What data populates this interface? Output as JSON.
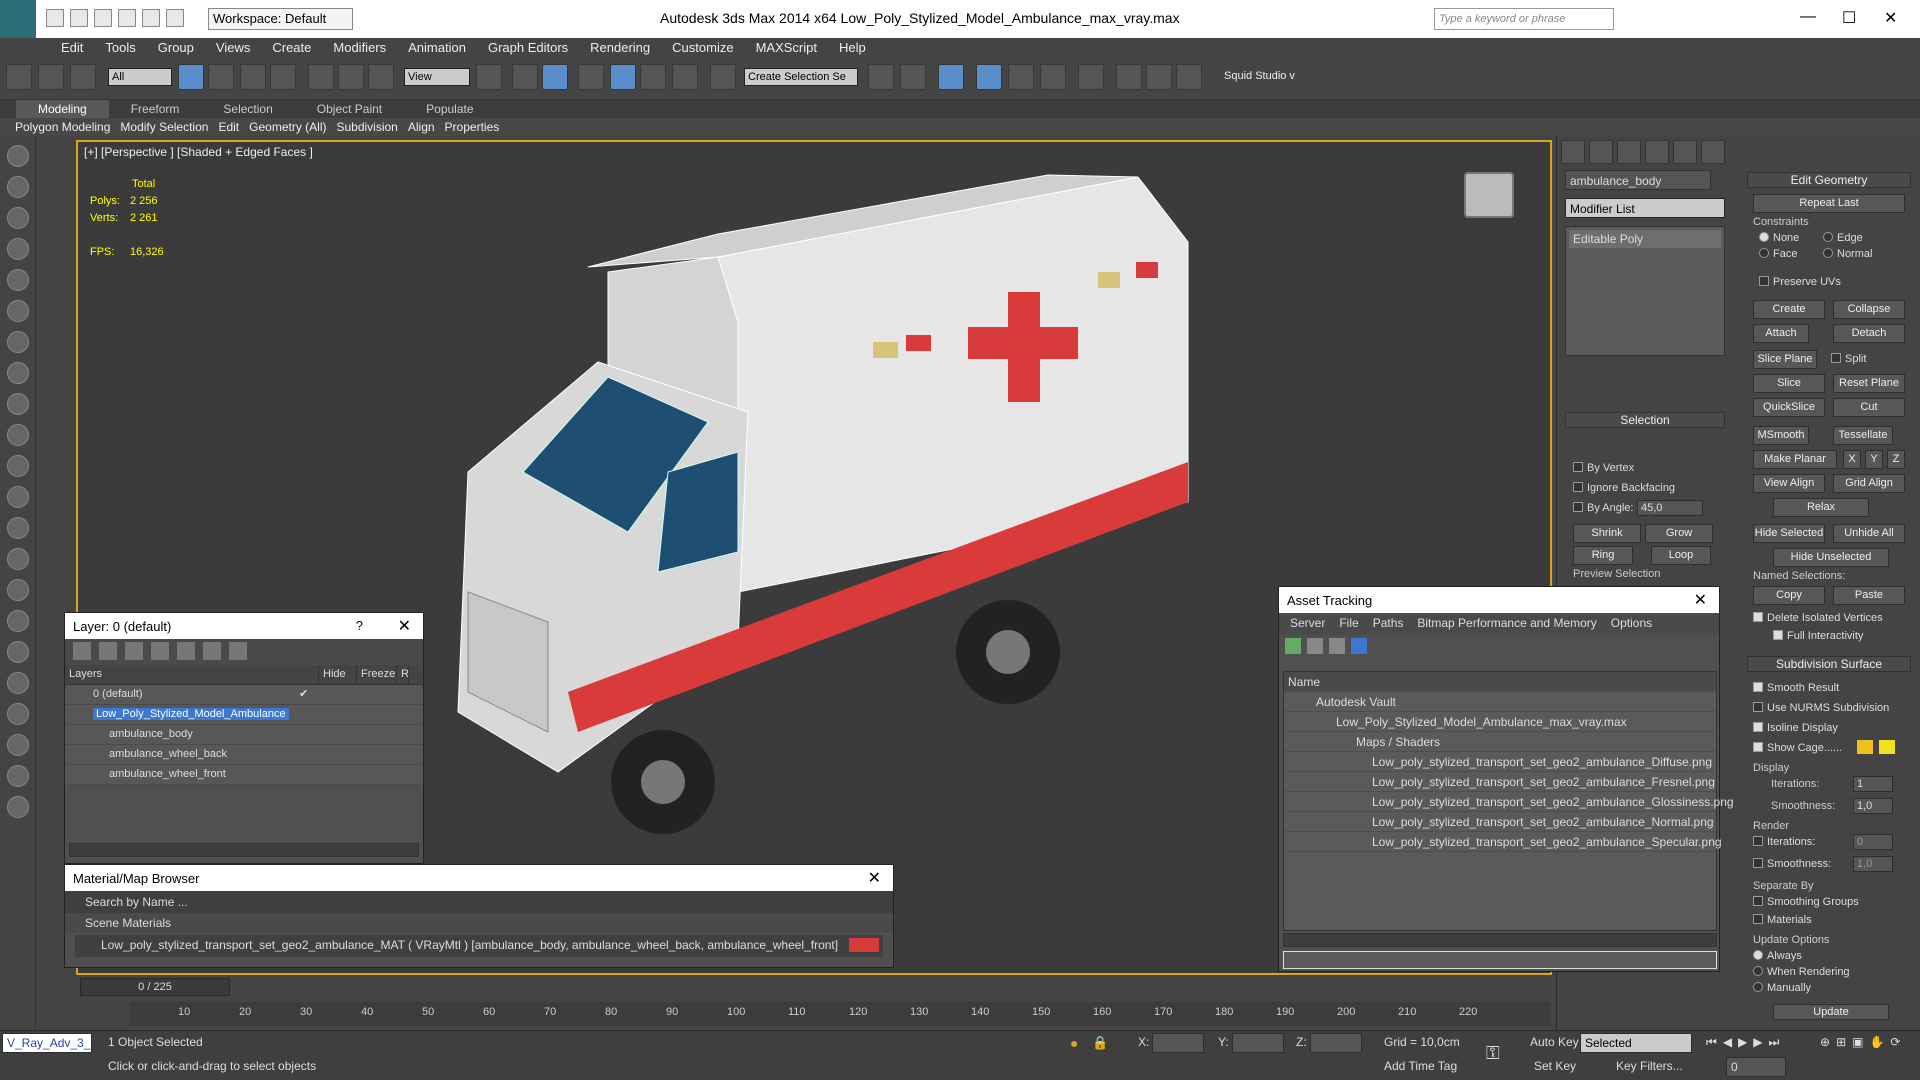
{
  "title": "Autodesk 3ds Max  2014 x64     Low_Poly_Stylized_Model_Ambulance_max_vray.max",
  "workspace": "Workspace: Default",
  "search_placeholder": "Type a keyword or phrase",
  "menu": [
    "Edit",
    "Tools",
    "Group",
    "Views",
    "Create",
    "Modifiers",
    "Animation",
    "Graph Editors",
    "Rendering",
    "Customize",
    "MAXScript",
    "Help"
  ],
  "toolbar": {
    "filter": "All",
    "refcoord": "View",
    "selset": "Create Selection Se",
    "studio": "Squid Studio v"
  },
  "ribbon_tabs": [
    "Modeling",
    "Freeform",
    "Selection",
    "Object Paint",
    "Populate"
  ],
  "ribbon_items": [
    "Polygon Modeling",
    "Modify Selection",
    "Edit",
    "Geometry (All)",
    "Subdivision",
    "Align",
    "Properties"
  ],
  "viewport": {
    "label": "[+] [Perspective ] [Shaded + Edged Faces ]",
    "total": "Total",
    "polys_label": "Polys:",
    "polys": "2 256",
    "verts_label": "Verts:",
    "verts": "2 261",
    "fps_label": "FPS:",
    "fps": "16,326"
  },
  "cmd": {
    "objname": "ambulance_body",
    "modlist": "Modifier List",
    "stack": "Editable Poly",
    "selection": "Selection",
    "by_vertex": "By Vertex",
    "ignore_backfacing": "Ignore Backfacing",
    "by_angle": "By Angle:",
    "angle": "45,0",
    "shrink": "Shrink",
    "grow": "Grow",
    "ring": "Ring",
    "loop": "Loop",
    "preview": "Preview Selection",
    "edit_geometry": "Edit Geometry",
    "repeat_last": "Repeat Last",
    "constraints": "Constraints",
    "none": "None",
    "edge": "Edge",
    "face": "Face",
    "normal": "Normal",
    "preserve_uvs": "Preserve UVs",
    "create": "Create",
    "collapse": "Collapse",
    "attach": "Attach",
    "detach": "Detach",
    "slice_plane": "Slice Plane",
    "split": "Split",
    "slice": "Slice",
    "reset_plane": "Reset Plane",
    "quickslice": "QuickSlice",
    "cut": "Cut",
    "msmooth": "MSmooth",
    "tessellate": "Tessellate",
    "make_planar": "Make Planar",
    "x": "X",
    "y": "Y",
    "z": "Z",
    "view_align": "View Align",
    "grid_align": "Grid Align",
    "relax": "Relax",
    "hide_selected": "Hide Selected",
    "unhide_all": "Unhide All",
    "hide_unselected": "Hide Unselected",
    "named_sel": "Named Selections:",
    "copy": "Copy",
    "paste": "Paste",
    "delete_iso": "Delete Isolated Vertices",
    "full_inter": "Full Interactivity",
    "subdiv": "Subdivision Surface",
    "smooth_result": "Smooth Result",
    "use_nurms": "Use NURMS Subdivision",
    "isoline": "Isoline Display",
    "show_cage": "Show Cage......",
    "display": "Display",
    "iterations": "Iterations:",
    "iter_val": "1",
    "smoothness": "Smoothness:",
    "smooth_val": "1,0",
    "render": "Render",
    "r_iter": "0",
    "r_smooth": "1,0",
    "separate_by": "Separate By",
    "smoothing_groups": "Smoothing Groups",
    "materials": "Materials",
    "update_options": "Update Options",
    "always": "Always",
    "when_rendering": "When Rendering",
    "manually": "Manually",
    "update": "Update"
  },
  "layer": {
    "title": "Layer: 0 (default)",
    "help": "?",
    "col_layers": "Layers",
    "col_hide": "Hide",
    "col_freeze": "Freeze",
    "col_r": "R",
    "rows": [
      "0 (default)",
      "Low_Poly_Stylized_Model_Ambulance",
      "ambulance_body",
      "ambulance_wheel_back",
      "ambulance_wheel_front"
    ]
  },
  "matbrowser": {
    "title": "Material/Map Browser",
    "search": "Search by Name ...",
    "scene": "Scene Materials",
    "item": "Low_poly_stylized_transport_set_geo2_ambulance_MAT ( VRayMtl ) [ambulance_body, ambulance_wheel_back, ambulance_wheel_front]"
  },
  "asset": {
    "title": "Asset Tracking",
    "menu": [
      "Server",
      "File",
      "Paths",
      "Bitmap Performance and Memory",
      "Options"
    ],
    "col_name": "Name",
    "rows": [
      "Autodesk Vault",
      "Low_Poly_Stylized_Model_Ambulance_max_vray.max",
      "Maps / Shaders",
      "Low_poly_stylized_transport_set_geo2_ambulance_Diffuse.png",
      "Low_poly_stylized_transport_set_geo2_ambulance_Fresnel.png",
      "Low_poly_stylized_transport_set_geo2_ambulance_Glossiness.png",
      "Low_poly_stylized_transport_set_geo2_ambulance_Normal.png",
      "Low_poly_stylized_transport_set_geo2_ambulance_Specular.png"
    ]
  },
  "timeline": {
    "frame": "0 / 225",
    "ticks": [
      "10",
      "20",
      "30",
      "40",
      "50",
      "60",
      "70",
      "80",
      "90",
      "100",
      "110",
      "120",
      "130",
      "140",
      "150",
      "160",
      "170",
      "180",
      "190",
      "200",
      "210",
      "220"
    ]
  },
  "status": {
    "script": "V_Ray_Adv_3_",
    "selected": "1 Object Selected",
    "prompt": "Click or click-and-drag to select objects",
    "x_label": "X:",
    "y_label": "Y:",
    "z_label": "Z:",
    "grid": "Grid = 10,0cm",
    "autokey": "Auto Key",
    "setkey": "Set Key",
    "keymode": "Selected",
    "keyfilters": "Key Filters...",
    "addtime": "Add Time Tag",
    "frame": "0"
  },
  "colors": {
    "accent": "#3a78d2",
    "viewport_border": "#d9a520",
    "cross": "#d93a3a"
  }
}
